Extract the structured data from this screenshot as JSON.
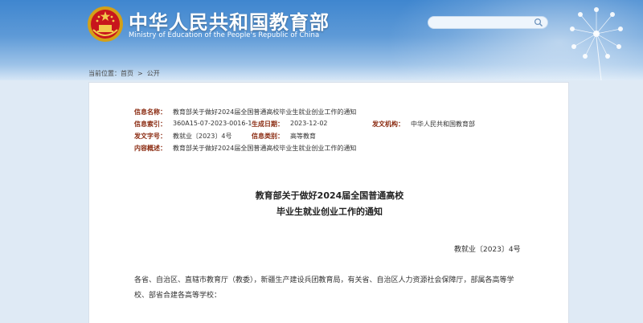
{
  "header": {
    "title": "中华人民共和国教育部",
    "subtitle": "Ministry of Education of the People's Republic of China",
    "emblem_icon": "national-emblem-icon",
    "search": {
      "placeholder": "",
      "icon": "search-icon"
    },
    "decor_icon": "dandelion-icon",
    "colors": {
      "banner_top": "#3f86cf",
      "banner_bottom": "#d7e7f6",
      "label_red": "#8a2a10"
    }
  },
  "breadcrumb": {
    "prefix": "当前位置：",
    "items": [
      "首页",
      "公开"
    ],
    "separator": ">"
  },
  "meta": {
    "index_name_label": "信息名称：",
    "index_name_value": "教育部关于做好2024届全国普通高校毕业生就业创业工作的通知",
    "index_no_label": "信息索引：",
    "index_no_value": "360A15-07-2023-0016-1",
    "date_label": "生成日期：",
    "date_value": "2023-12-02",
    "issuer_label": "发文机构：",
    "issuer_value": "中华人民共和国教育部",
    "docno_label": "发文字号：",
    "docno_value": "教就业〔2023〕4号",
    "category_label": "信息类别：",
    "category_value": "高等教育",
    "summary_label": "内容概述：",
    "summary_value": "教育部关于做好2024届全国普通高校毕业生就业创业工作的通知"
  },
  "article": {
    "title_line1": "教育部关于做好2024届全国普通高校",
    "title_line2": "毕业生就业创业工作的通知",
    "doc_number": "教就业〔2023〕4号",
    "salutation": "各省、自治区、直辖市教育厅（教委），新疆生产建设兵团教育局，有关省、自治区人力资源社会保障厅，部属各高等学校、部省合建各高等学校："
  }
}
